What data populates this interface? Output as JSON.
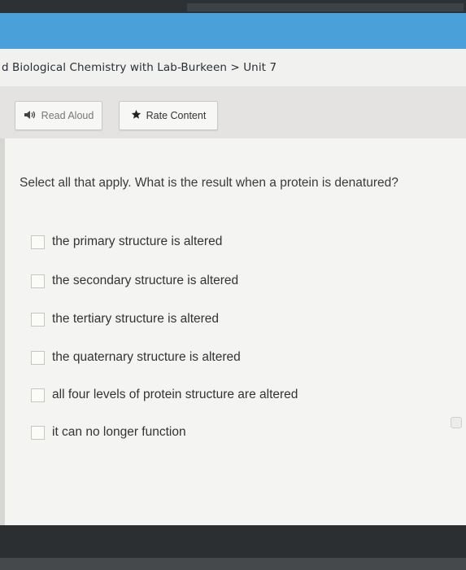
{
  "breadcrumb": {
    "text": "d Biological Chemistry with Lab-Burkeen > Unit 7"
  },
  "toolbar": {
    "read_aloud_label": "Read Aloud",
    "rate_content_label": "Rate Content"
  },
  "question": {
    "prompt": "Select all that apply. What is the result when a protein is denatured?",
    "options": [
      {
        "label": "the primary structure is altered",
        "checked": false
      },
      {
        "label": "the secondary structure is altered",
        "checked": false
      },
      {
        "label": "the tertiary structure is altered",
        "checked": false
      },
      {
        "label": "the quaternary structure is altered",
        "checked": false
      },
      {
        "label": "all four levels of protein structure are altered",
        "checked": false
      },
      {
        "label": "it can no longer function",
        "checked": false
      }
    ]
  },
  "colors": {
    "header_blue": "#4aa0d8",
    "background": "#f4f4f3"
  },
  "icons": {
    "read_aloud": "speaker-icon",
    "rate_content": "star-icon"
  }
}
